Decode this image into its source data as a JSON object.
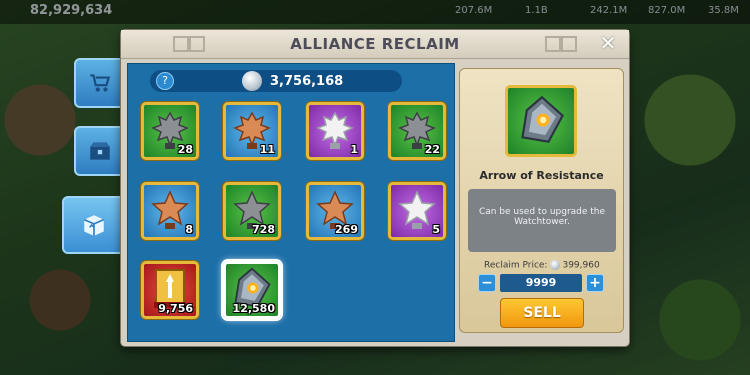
{
  "top_bar": {
    "gems": "82,929,634",
    "resources": [
      "207.6M",
      "1.1B",
      "242.1M",
      "827.0M",
      "35.8M"
    ]
  },
  "dialog": {
    "title": "ALLIANCE RECLAIM",
    "currency_amount": "3,756,168",
    "help_symbol": "?",
    "close_symbol": "✕"
  },
  "side_tabs": [
    {
      "icon": "cart-icon"
    },
    {
      "icon": "chest-icon"
    },
    {
      "icon": "recycle-box-icon",
      "active": true
    }
  ],
  "items": [
    {
      "count": "28",
      "bg": "green",
      "icon": "gray-spiked-trophy-icon"
    },
    {
      "count": "11",
      "bg": "blue",
      "icon": "bronze-spiked-trophy-icon"
    },
    {
      "count": "1",
      "bg": "purple",
      "icon": "silver-spiked-trophy-icon"
    },
    {
      "count": "22",
      "bg": "green",
      "icon": "gray-spiked-trophy-icon"
    },
    {
      "count": "8",
      "bg": "blue",
      "icon": "bronze-star-trophy-icon"
    },
    {
      "count": "728",
      "bg": "green",
      "icon": "gray-star-trophy-icon"
    },
    {
      "count": "269",
      "bg": "blue",
      "icon": "bronze-star-trophy-icon"
    },
    {
      "count": "5",
      "bg": "purple",
      "icon": "silver-star-trophy-icon"
    },
    {
      "count": "9,756",
      "bg": "red",
      "icon": "banner-icon"
    },
    {
      "count": "12,580",
      "bg": "green",
      "icon": "arrowhead-icon",
      "selected": true
    }
  ],
  "detail": {
    "name": "Arrow of Resistance",
    "description": "Can be used to upgrade the Watchtower.",
    "price_label": "Reclaim Price:",
    "price_value": "399,960",
    "quantity": "9999",
    "minus": "−",
    "plus": "+",
    "sell_label": "SELL"
  }
}
